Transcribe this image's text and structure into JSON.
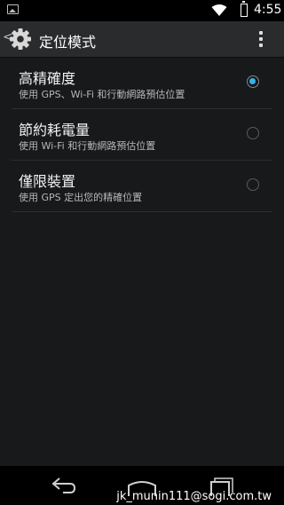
{
  "status_bar": {
    "time": "4:55",
    "icons": [
      "image-notification-icon",
      "wifi-icon",
      "battery-icon"
    ]
  },
  "action_bar": {
    "title": "定位模式",
    "icons": [
      "back-caret-icon",
      "settings-gear-icon",
      "overflow-menu-icon"
    ]
  },
  "options": [
    {
      "title": "高精確度",
      "subtitle": "使用 GPS、Wi-Fi 和行動網路預估位置",
      "selected": true
    },
    {
      "title": "節約耗電量",
      "subtitle": "使用 Wi-Fi 和行動網路預估位置",
      "selected": false
    },
    {
      "title": "僅限裝置",
      "subtitle": "使用 GPS 定出您的精確位置",
      "selected": false
    }
  ],
  "navigation_bar": {
    "icons": [
      "back-arrow-icon",
      "home-icon",
      "recents-icon"
    ]
  },
  "watermark": "jk_munin111@sogi.com.tw",
  "colors": {
    "accent": "#33b5e5",
    "background": "#18191b",
    "action_bar": "#2a2b2d"
  }
}
